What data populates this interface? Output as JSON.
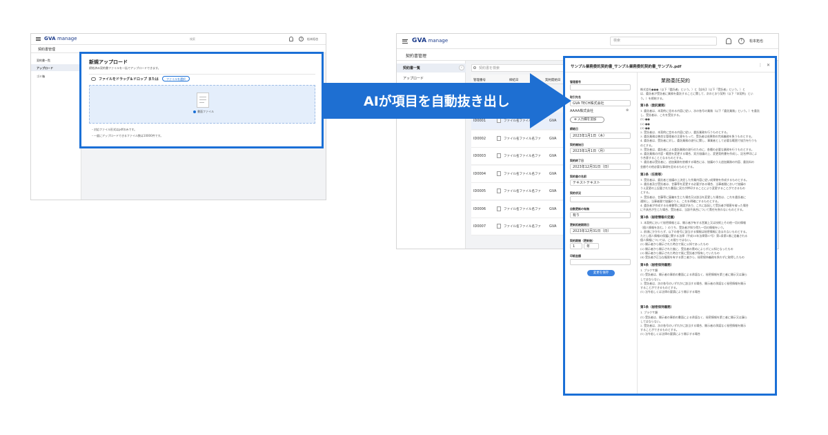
{
  "banner": {
    "text": "AIが項目を自動抜き出し"
  },
  "left": {
    "logo_bold": "GVA",
    "logo_rest": " manage",
    "search_placeholder": "検索",
    "user": "松本拓也",
    "section_title": "契約書管理",
    "sidebar": [
      {
        "label": "契約書一覧"
      },
      {
        "label": "アップロード"
      },
      {
        "label": "ゴミ箱"
      }
    ],
    "upload": {
      "title": "新規アップロード",
      "description": "締結済み契約書ファイルを一括でアップロードできます。",
      "drop_text": "ファイルをドラッグ＆ドロップ または",
      "select_button": "ファイルを選択",
      "file_label": "書面ファイル",
      "notes": [
        "・対応ファイル形式はpdfのみです。",
        "・一度にアップロードできるファイル数は10000件です。"
      ]
    }
  },
  "right": {
    "logo_bold": "GVA",
    "logo_rest": " manage",
    "search_placeholder": "検索",
    "user": "松本拓也",
    "section_title": "契約書管理",
    "sidebar": [
      {
        "label": "契約書一覧"
      },
      {
        "label": "アップロード"
      }
    ],
    "table_search_placeholder": "契約書を検索",
    "columns": [
      "管理番号",
      "締結日",
      "契約開始日"
    ],
    "rows": [
      {
        "id": "ID0001",
        "file": "ファイル名ファイル名ファ",
        "party": "GVA"
      },
      {
        "id": "ID0002",
        "file": "ファイル名ファイル名ファ",
        "party": "GVA"
      },
      {
        "id": "ID0003",
        "file": "ファイル名ファイル名ファ",
        "party": "GVA"
      },
      {
        "id": "ID0004",
        "file": "ファイル名ファイル名ファ",
        "party": "GVA"
      },
      {
        "id": "ID0005",
        "file": "ファイル名ファイル名ファ",
        "party": "GVA"
      },
      {
        "id": "ID0006",
        "file": "ファイル名ファイル名ファ",
        "party": "GVA"
      },
      {
        "id": "ID0007",
        "file": "ファイル名ファイル名ファ",
        "party": "GVA"
      }
    ],
    "panel": {
      "filename": "サンプル業務委託契約書_サンプル業務委託契約書_サンプル.pdf",
      "fields": {
        "mgmt_label": "管理番号",
        "mgmt_value": "",
        "party_label": "取引先名",
        "party_value1": "GVA TECH株式会社",
        "party_value2": "AAAA株式会社",
        "add_button": "入力欄を追加",
        "signed_label": "締結日",
        "signed_value": "2023年1月1日（木）",
        "start_label": "契約開始日",
        "start_value": "2023年1月1日（月）",
        "end_label": "契約終了日",
        "end_value": "2023年12月31日（日）",
        "title_label": "契約書の名前",
        "title_value": "テキストテキスト",
        "status_label": "契約状況",
        "renew_label": "自動更新の有無",
        "renew_value": "有り",
        "notice_label": "更新拒絶期限日",
        "notice_value": "2023年12月31日（日）",
        "period_label": "契約期間（更新後）",
        "period_num": "1",
        "period_unit": "年",
        "stamp_label": "印紙金額",
        "save_button": "変更を保存"
      },
      "doc": {
        "title": "業務委託契約",
        "intro": [
          "株式会社●●●（以下「委託者」という。）と【自社】（以下「受託者」という。）と",
          "は、委託者が受託者に業務を委託することに関して、次のとおり契約（以下「本契約」とい",
          "う。）を締結する。"
        ],
        "sections": [
          {
            "head": "第1条（委託業務）",
            "lines": [
              "1. 委託者は、本契約に定める内容に従い、次の各号の業務（以下「委託業務」という。）を委託",
              "し、受託者は、これを受託する。",
              "(1) ●●",
              "(2) ●●",
              "(3) ●●",
              "2. 受託者は、本契約に定める内容に従い、委託業務を行うものとする。",
              "3. 委託業務は善良な管理者の注意をもって、受託者は成果物の完成義務を負うものとする。",
              "4. 委託者は、受託者に対し、委託業務の遂行に関し、事業者として必要な範囲で協力を行うも",
              "のとする。",
              "5. 受託者は、委託者による委託業務の遂行のために、各種の必要な業務を行うものとする。",
              "6. 委託業務の内容・範囲を変更する場合、双方協議の上、変更契約書を作成し、記名押印によ",
              "り合意することとなるものとする。",
              "7. 委託者は受託者に、追加業務を依頼する場合には、協議のうえ追加業務の内容、委託料の",
              "金額その他必要な事項を定めるものとする。"
            ]
          },
          {
            "head": "第2条（任務等）",
            "lines": [
              "1. 受託者は、委託者と協議の上決定した作業内容に従い成果物を作成するものとする。",
              "2. 委託者及び受託者は、甘藤等を変更する必要がある場合、当事者間において協議の",
              "うえ変更の上記載された書面に双方が押印することにより変更することができるもの",
              "とする。",
              "3. 受託者は、甘藤等に疑義を生じた場合又は該当を変更した場合は、これを委託者に",
              "通知し、当事者間で協議のうえ、これを明確にするものとする。",
              "4. 委託者が作成する仕様書等に過誤があり、これに起因して受託者が損害を被った場合",
              "に不具合が生じた場合、受託者は、当該不具合について責任を負わないものとする。"
            ]
          },
          {
            "head": "第3条（秘密情報の定義）",
            "lines": [
              "1. 本契約において秘密情報とは、開示者が有する営業上又は技術上その他一切の情報",
              "（個人情報を含む。）のうち、受託者が知り得た一切の情報をいう。",
              "2. 前項にかかわらず、以下の各号に該当する情報は秘密情報に含まれないものとする。",
              "ただし個人情報の保護に関する法律（平成15年法律第57号）第2条第1項に定義される",
              "個人情報については、この限りではない。",
              "(1) 開示者から開示された時点で既に公知であったもの",
              "(2) 開示者から開示された後に、受託者の責めによらずに公知となったもの",
              "(3) 開示者から開示された時点で既に受託者が保有していたもの",
              "(4) 受託者が正当な権限を有する第三者から、秘密保持義務を負わずに取得したもの"
            ]
          },
          {
            "head": "第4条（秘密保持義務）",
            "lines": [
              "1. プラクサ類",
              "(1) 受託者は、開示者の事前の書面による承諾なく、秘密情報を第三者に開示又は漏ら",
              "してはならない。",
              "2. 受託者は、次の各号のいずれかに該当する場合、開示者の承諾なく秘密情報を開示",
              "することができるものとする。",
              "(1) 法令若しくは法律の要請により開示する場合"
            ]
          },
          {
            "head": "第5条（秘密保持義務）",
            "lines": [
              "1. プラクサ類",
              "(1) 受託者は、開示者の事前の書面による承諾なく、秘密情報を第三者に開示又は漏ら",
              "してはならない。",
              "2. 受託者は、次の各号のいずれかに該当する場合、開示者の承諾なく秘密情報を開示",
              "することができるものとする。",
              "(1) 法令若しくは法律の要請により開示する場合"
            ]
          }
        ]
      }
    }
  },
  "colors": {
    "accent": "#1a6fd6",
    "banner": "#1e6fd2",
    "logo": "#1a3a8a",
    "save": "#3b82e0"
  }
}
